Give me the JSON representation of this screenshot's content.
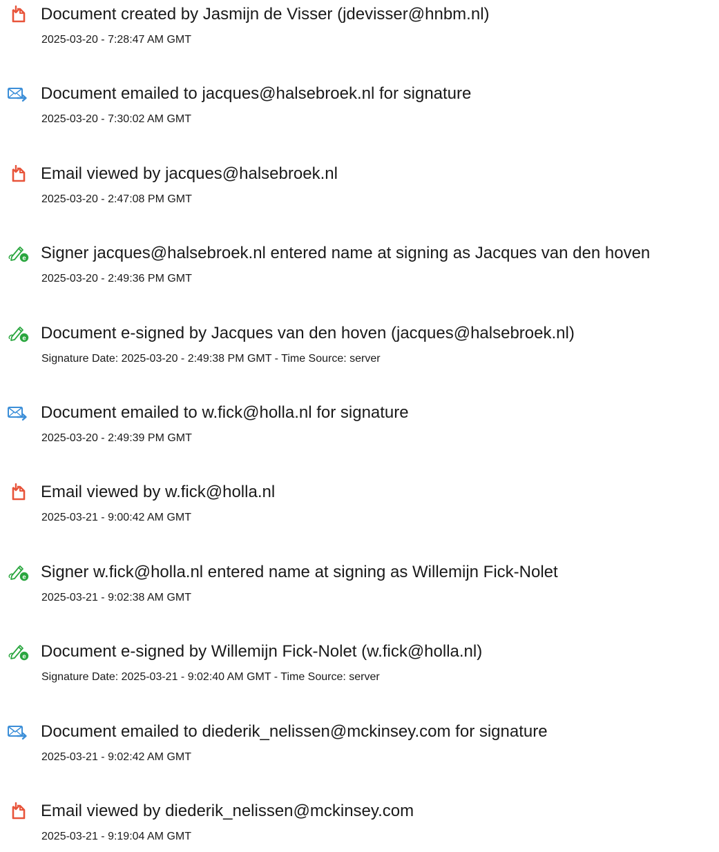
{
  "audit_events": [
    {
      "icon": "document-icon",
      "title": "Document created by Jasmijn de Visser (jdevisser@hnbm.nl)",
      "detail": "2025-03-20 - 7:28:47 AM GMT"
    },
    {
      "icon": "email-sent-icon",
      "title": "Document emailed to jacques@halsebroek.nl for signature",
      "detail": "2025-03-20 - 7:30:02 AM GMT"
    },
    {
      "icon": "document-icon",
      "title": "Email viewed by jacques@halsebroek.nl",
      "detail": "2025-03-20 - 2:47:08 PM GMT"
    },
    {
      "icon": "esign-pen-icon",
      "title": "Signer jacques@halsebroek.nl entered name at signing as Jacques van den hoven",
      "detail": "2025-03-20 - 2:49:36 PM GMT"
    },
    {
      "icon": "esign-pen-icon",
      "title": "Document e-signed by Jacques van den hoven (jacques@halsebroek.nl)",
      "detail": "Signature Date: 2025-03-20 - 2:49:38 PM GMT - Time Source: server"
    },
    {
      "icon": "email-sent-icon",
      "title": "Document emailed to w.fick@holla.nl for signature",
      "detail": "2025-03-20 - 2:49:39 PM GMT"
    },
    {
      "icon": "document-icon",
      "title": "Email viewed by w.fick@holla.nl",
      "detail": "2025-03-21 - 9:00:42 AM GMT"
    },
    {
      "icon": "esign-pen-icon",
      "title": "Signer w.fick@holla.nl entered name at signing as Willemijn Fick-Nolet",
      "detail": "2025-03-21 - 9:02:38 AM GMT"
    },
    {
      "icon": "esign-pen-icon",
      "title": "Document e-signed by Willemijn Fick-Nolet (w.fick@holla.nl)",
      "detail": "Signature Date: 2025-03-21 - 9:02:40 AM GMT - Time Source: server"
    },
    {
      "icon": "email-sent-icon",
      "title": "Document emailed to diederik_nelissen@mckinsey.com for signature",
      "detail": "2025-03-21 - 9:02:42 AM GMT"
    },
    {
      "icon": "document-icon",
      "title": "Email viewed by diederik_nelissen@mckinsey.com",
      "detail": "2025-03-21 - 9:19:04 AM GMT"
    }
  ],
  "colors": {
    "document_icon": "#e8543a",
    "email_icon": "#3b8ed8",
    "esign_icon": "#2aa63f"
  }
}
